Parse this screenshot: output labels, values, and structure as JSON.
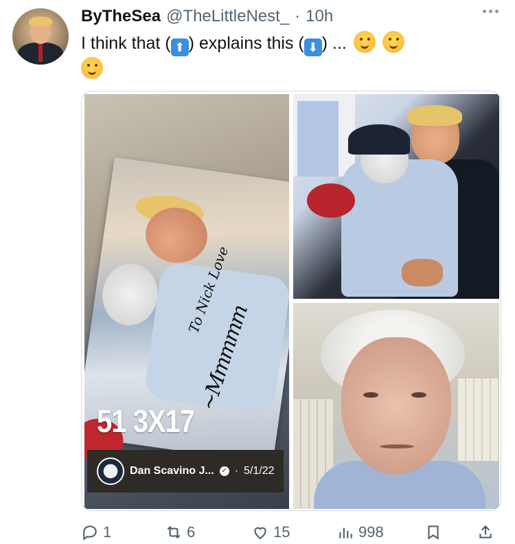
{
  "tweet": {
    "display_name": "ByTheSea",
    "handle": "@TheLittleNest_",
    "separator": "·",
    "time": "10h",
    "text_part1": "I think that (",
    "up_emoji": "⬆",
    "text_part2": ")  explains this (",
    "down_emoji": "⬇",
    "text_part3": ")  ...",
    "emoji_names": [
      "hugging-face-emoji",
      "hugging-face-emoji",
      "hugging-face-emoji"
    ]
  },
  "media": {
    "left_photo": {
      "overlay_text": "51 3X17",
      "handwriting": "To Nick Love",
      "embedded_post": {
        "name": "Dan Scavino J...",
        "verified_icon": "verified-badge-icon",
        "separator": "·",
        "date": "5/1/22"
      }
    },
    "top_right_photo": {
      "description_icon": "photo"
    },
    "bottom_right_photo": {
      "description_icon": "photo"
    }
  },
  "actions": {
    "reply_count": "1",
    "retweet_count": "6",
    "like_count": "15",
    "views_count": "998",
    "icons": [
      "reply-icon",
      "retweet-icon",
      "like-icon",
      "views-icon",
      "bookmark-icon",
      "share-icon"
    ]
  },
  "colors": {
    "text_primary": "#0f1419",
    "text_secondary": "#536471",
    "border": "#cfd9de"
  }
}
